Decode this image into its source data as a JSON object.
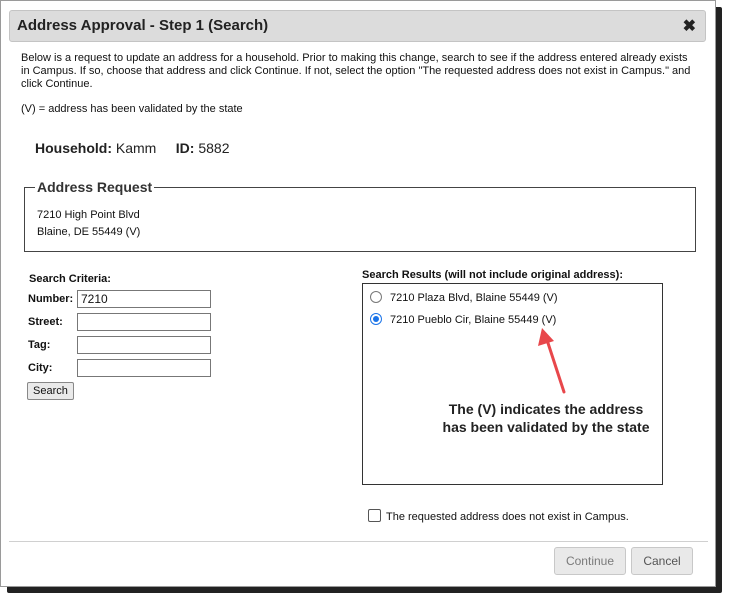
{
  "dialog": {
    "title": "Address Approval - Step 1 (Search)",
    "close_glyph": "✖",
    "intro": "Below is a request to update an address for a household. Prior to making this change, search to see if the address entered already exists in Campus. If so, choose that address and click Continue. If not, select the option \"The requested address does not exist in Campus.\" and click Continue.",
    "legend_note": "(V) = address has been validated by the state"
  },
  "household": {
    "label": "Household:",
    "name": "Kamm",
    "id_label": "ID:",
    "id": "5882"
  },
  "address_request": {
    "legend": "Address Request",
    "line1": "7210 High Point Blvd",
    "line2": "Blaine, DE 55449 (V)"
  },
  "search_criteria": {
    "title": "Search Criteria:",
    "fields": [
      {
        "label": "Number:",
        "value": "7210"
      },
      {
        "label": "Street:",
        "value": ""
      },
      {
        "label": "Tag:",
        "value": ""
      },
      {
        "label": "City:",
        "value": ""
      }
    ],
    "search_button": "Search"
  },
  "search_results": {
    "title": "Search Results (will not include original address):",
    "items": [
      {
        "label": "7210 Plaza Blvd, Blaine 55449 (V)",
        "selected": false
      },
      {
        "label": "7210 Pueblo Cir, Blaine 55449 (V)",
        "selected": true
      }
    ]
  },
  "annotation": {
    "line1": "The (V) indicates the address",
    "line2": "has been validated by the state",
    "arrow_color": "#e8474b"
  },
  "not_exist_checkbox": {
    "label": "The requested address does not exist in Campus.",
    "checked": false
  },
  "footer": {
    "continue_label": "Continue",
    "cancel_label": "Cancel"
  },
  "colors": {
    "accent": "#1a73e8",
    "titlebar": "#dcdcdc"
  },
  "icons": {
    "close": "close-icon",
    "arrow": "arrow-icon"
  }
}
